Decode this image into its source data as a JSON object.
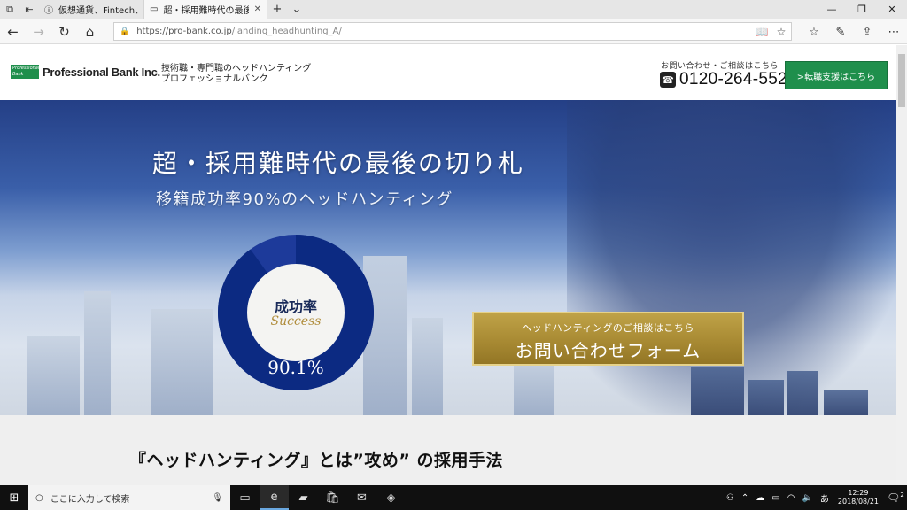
{
  "browser": {
    "tabs": [
      {
        "title": "仮想通貨、Fintech、資産運用",
        "active": false
      },
      {
        "title": "超・採用難時代の最後の切り札",
        "active": true
      }
    ],
    "url_host": "https://pro-bank.co.jp",
    "url_path": "/landing_headhunting_A/"
  },
  "site": {
    "logo_badge": "Professional Bank",
    "logo_text": "Professional Bank Inc.",
    "tagline_1": "技術職・専門職のヘッドハンティング",
    "tagline_2": "プロフェッショナルバンク",
    "contact_label": "お問い合わせ・ご相談はこちら",
    "phone": "0120-264-552",
    "career_button": ">転職支援はこちら"
  },
  "hero": {
    "title": "超・採用難時代の最後の切り札",
    "subtitle": "移籍成功率90%のヘッドハンティング",
    "success_jp": "成功率",
    "success_en": "Success",
    "success_value": "90.1%",
    "success_fraction": 0.901,
    "cta_small": "ヘッドハンティングのご相談はこちら",
    "cta_big": "お問い合わせフォーム"
  },
  "section": {
    "title": "『ヘッドハンティング』とは”攻め” の採用手法"
  },
  "taskbar": {
    "search_placeholder": "ここに入力して検索",
    "ime": "あ",
    "time": "12:29",
    "date": "2018/08/21",
    "notifications": "2"
  },
  "colors": {
    "brand_green": "#1f8f4c",
    "cta_gold": "#a88a33",
    "donut_navy": "#0c2a82"
  }
}
